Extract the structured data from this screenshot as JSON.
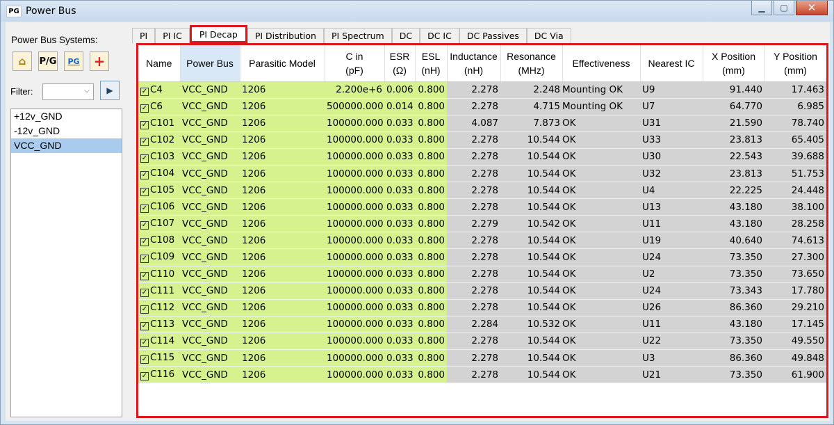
{
  "window": {
    "title": "Power Bus",
    "app_icon": "PG"
  },
  "left_panel": {
    "label": "Power Bus Systems:",
    "tool_buttons": [
      {
        "name": "home-icon",
        "glyph": "⌂"
      },
      {
        "name": "pg-icon",
        "glyph": "P/G"
      },
      {
        "name": "pg-select-icon",
        "glyph": "PG"
      },
      {
        "name": "plus-icon",
        "glyph": "+"
      }
    ],
    "filter_label": "Filter:",
    "filter_value": "",
    "systems": [
      "+12v_GND",
      "-12v_GND",
      "VCC_GND"
    ],
    "selected_system": "VCC_GND"
  },
  "tabs": [
    {
      "label": "PI",
      "active": false
    },
    {
      "label": "PI IC",
      "active": false
    },
    {
      "label": "PI Decap",
      "active": true
    },
    {
      "label": "PI Distribution",
      "active": false
    },
    {
      "label": "PI Spectrum",
      "active": false
    },
    {
      "label": "DC",
      "active": false
    },
    {
      "label": "DC IC",
      "active": false
    },
    {
      "label": "DC Passives",
      "active": false
    },
    {
      "label": "DC Via",
      "active": false
    }
  ],
  "table": {
    "columns": [
      {
        "line1": "Name",
        "line2": ""
      },
      {
        "line1": "Power Bus",
        "line2": ""
      },
      {
        "line1": "Parasitic Model",
        "line2": ""
      },
      {
        "line1": "C in",
        "line2": "(pF)"
      },
      {
        "line1": "ESR",
        "line2": "(Ω)"
      },
      {
        "line1": "ESL",
        "line2": "(nH)"
      },
      {
        "line1": "Inductance",
        "line2": "(nH)"
      },
      {
        "line1": "Resonance",
        "line2": "(MHz)"
      },
      {
        "line1": "Effectiveness",
        "line2": ""
      },
      {
        "line1": "Nearest IC",
        "line2": ""
      },
      {
        "line1": "X Position",
        "line2": "(mm)"
      },
      {
        "line1": "Y Position",
        "line2": "(mm)"
      }
    ],
    "rows": [
      [
        "C4",
        "VCC_GND",
        "1206",
        "2.200e+6",
        "0.006",
        "0.800",
        "2.278",
        "2.248",
        "Mounting OK",
        "U9",
        "91.440",
        "17.463"
      ],
      [
        "C6",
        "VCC_GND",
        "1206",
        "500000.000",
        "0.014",
        "0.800",
        "2.278",
        "4.715",
        "Mounting OK",
        "U7",
        "64.770",
        "6.985"
      ],
      [
        "C101",
        "VCC_GND",
        "1206",
        "100000.000",
        "0.033",
        "0.800",
        "4.087",
        "7.873",
        "OK",
        "U31",
        "21.590",
        "78.740"
      ],
      [
        "C102",
        "VCC_GND",
        "1206",
        "100000.000",
        "0.033",
        "0.800",
        "2.278",
        "10.544",
        "OK",
        "U33",
        "23.813",
        "65.405"
      ],
      [
        "C103",
        "VCC_GND",
        "1206",
        "100000.000",
        "0.033",
        "0.800",
        "2.278",
        "10.544",
        "OK",
        "U30",
        "22.543",
        "39.688"
      ],
      [
        "C104",
        "VCC_GND",
        "1206",
        "100000.000",
        "0.033",
        "0.800",
        "2.278",
        "10.544",
        "OK",
        "U32",
        "23.813",
        "51.753"
      ],
      [
        "C105",
        "VCC_GND",
        "1206",
        "100000.000",
        "0.033",
        "0.800",
        "2.278",
        "10.544",
        "OK",
        "U4",
        "22.225",
        "24.448"
      ],
      [
        "C106",
        "VCC_GND",
        "1206",
        "100000.000",
        "0.033",
        "0.800",
        "2.278",
        "10.544",
        "OK",
        "U13",
        "43.180",
        "38.100"
      ],
      [
        "C107",
        "VCC_GND",
        "1206",
        "100000.000",
        "0.033",
        "0.800",
        "2.279",
        "10.542",
        "OK",
        "U11",
        "43.180",
        "28.258"
      ],
      [
        "C108",
        "VCC_GND",
        "1206",
        "100000.000",
        "0.033",
        "0.800",
        "2.278",
        "10.544",
        "OK",
        "U19",
        "40.640",
        "74.613"
      ],
      [
        "C109",
        "VCC_GND",
        "1206",
        "100000.000",
        "0.033",
        "0.800",
        "2.278",
        "10.544",
        "OK",
        "U24",
        "73.350",
        "27.300"
      ],
      [
        "C110",
        "VCC_GND",
        "1206",
        "100000.000",
        "0.033",
        "0.800",
        "2.278",
        "10.544",
        "OK",
        "U2",
        "73.350",
        "73.650"
      ],
      [
        "C111",
        "VCC_GND",
        "1206",
        "100000.000",
        "0.033",
        "0.800",
        "2.278",
        "10.544",
        "OK",
        "U24",
        "73.343",
        "17.780"
      ],
      [
        "C112",
        "VCC_GND",
        "1206",
        "100000.000",
        "0.033",
        "0.800",
        "2.278",
        "10.544",
        "OK",
        "U26",
        "86.360",
        "29.210"
      ],
      [
        "C113",
        "VCC_GND",
        "1206",
        "100000.000",
        "0.033",
        "0.800",
        "2.284",
        "10.532",
        "OK",
        "U11",
        "43.180",
        "17.145"
      ],
      [
        "C114",
        "VCC_GND",
        "1206",
        "100000.000",
        "0.033",
        "0.800",
        "2.278",
        "10.544",
        "OK",
        "U22",
        "73.350",
        "49.550"
      ],
      [
        "C115",
        "VCC_GND",
        "1206",
        "100000.000",
        "0.033",
        "0.800",
        "2.278",
        "10.544",
        "OK",
        "U3",
        "86.360",
        "49.848"
      ],
      [
        "C116",
        "VCC_GND",
        "1206",
        "100000.000",
        "0.033",
        "0.800",
        "2.278",
        "10.544",
        "OK",
        "U21",
        "73.350",
        "61.900"
      ]
    ]
  },
  "colors": {
    "accent_red": "#e0161d",
    "green_cell": "#d5f28e",
    "gray_cell": "#d3d3d3",
    "selected_row": "#a9cbee"
  }
}
